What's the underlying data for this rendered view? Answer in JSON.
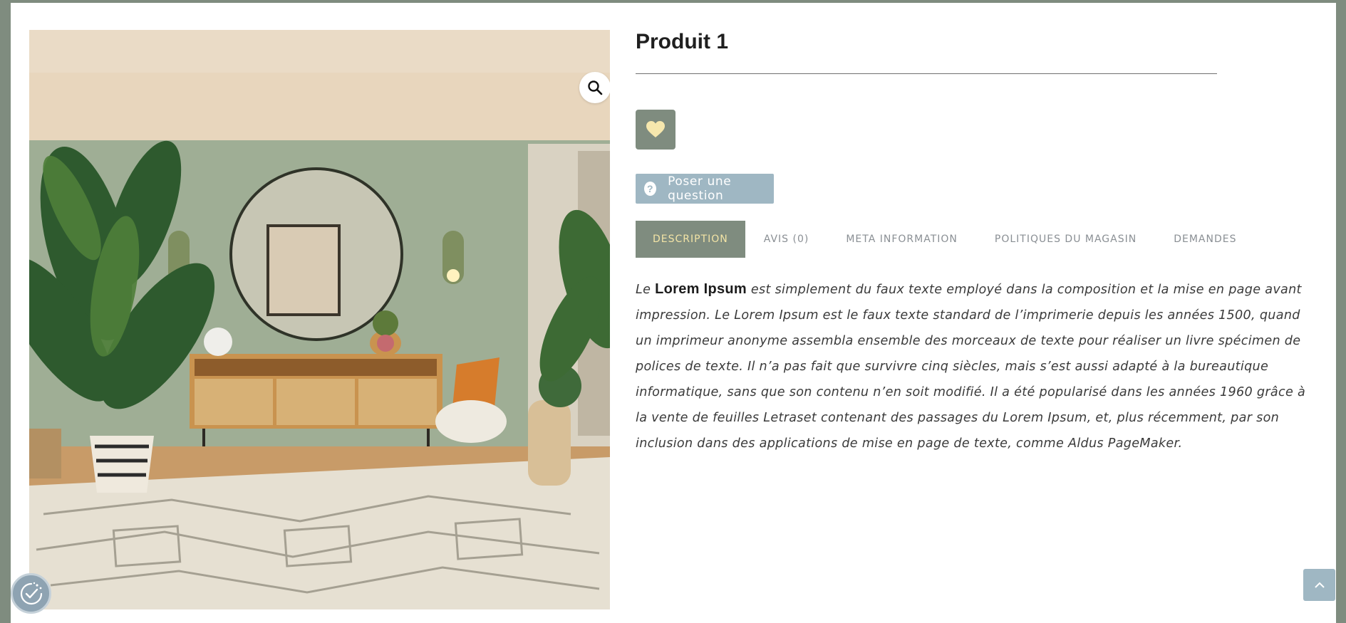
{
  "product": {
    "title": "Produit 1",
    "image_alt": "Salon avec miroir rond, buffet en rotin et tapis",
    "ask_question_label": "Poser une question"
  },
  "tabs": [
    {
      "label": "DESCRIPTION",
      "active": true
    },
    {
      "label": "AVIS (0)",
      "active": false
    },
    {
      "label": "META INFORMATION",
      "active": false
    },
    {
      "label": "POLITIQUES DU MAGASIN",
      "active": false
    },
    {
      "label": "DEMANDES",
      "active": false
    }
  ],
  "description": {
    "lead": "Le ",
    "bold": "Lorem Ipsum",
    "body": " est simplement du faux texte employé dans la composition et la mise en page avant impression. Le Lorem Ipsum est le faux texte standard de l’imprimerie depuis les années 1500, quand un imprimeur anonyme assembla ensemble des morceaux de texte pour réaliser un livre spécimen de polices de texte. Il n’a pas fait que survivre cinq siècles, mais s’est aussi adapté à la bureautique informatique, sans que son contenu n’en soit modifié. Il a été popularisé dans les années 1960 grâce à la vente de feuilles Letraset contenant des passages du Lorem Ipsum, et, plus récemment, par son inclusion dans des applications de mise en page de texte, comme Aldus PageMaker."
  },
  "icons": {
    "zoom": "magnifier-icon",
    "wishlist": "heart-icon",
    "ask": "question-circle-icon",
    "cookie": "cookie-consent-icon",
    "back_to_top": "chevron-up-icon"
  },
  "colors": {
    "sage": "#7f8c7f",
    "tab_active_text": "#f3e4a6",
    "blue_grey": "#9fb7c3",
    "heart": "#f6e7ad"
  }
}
